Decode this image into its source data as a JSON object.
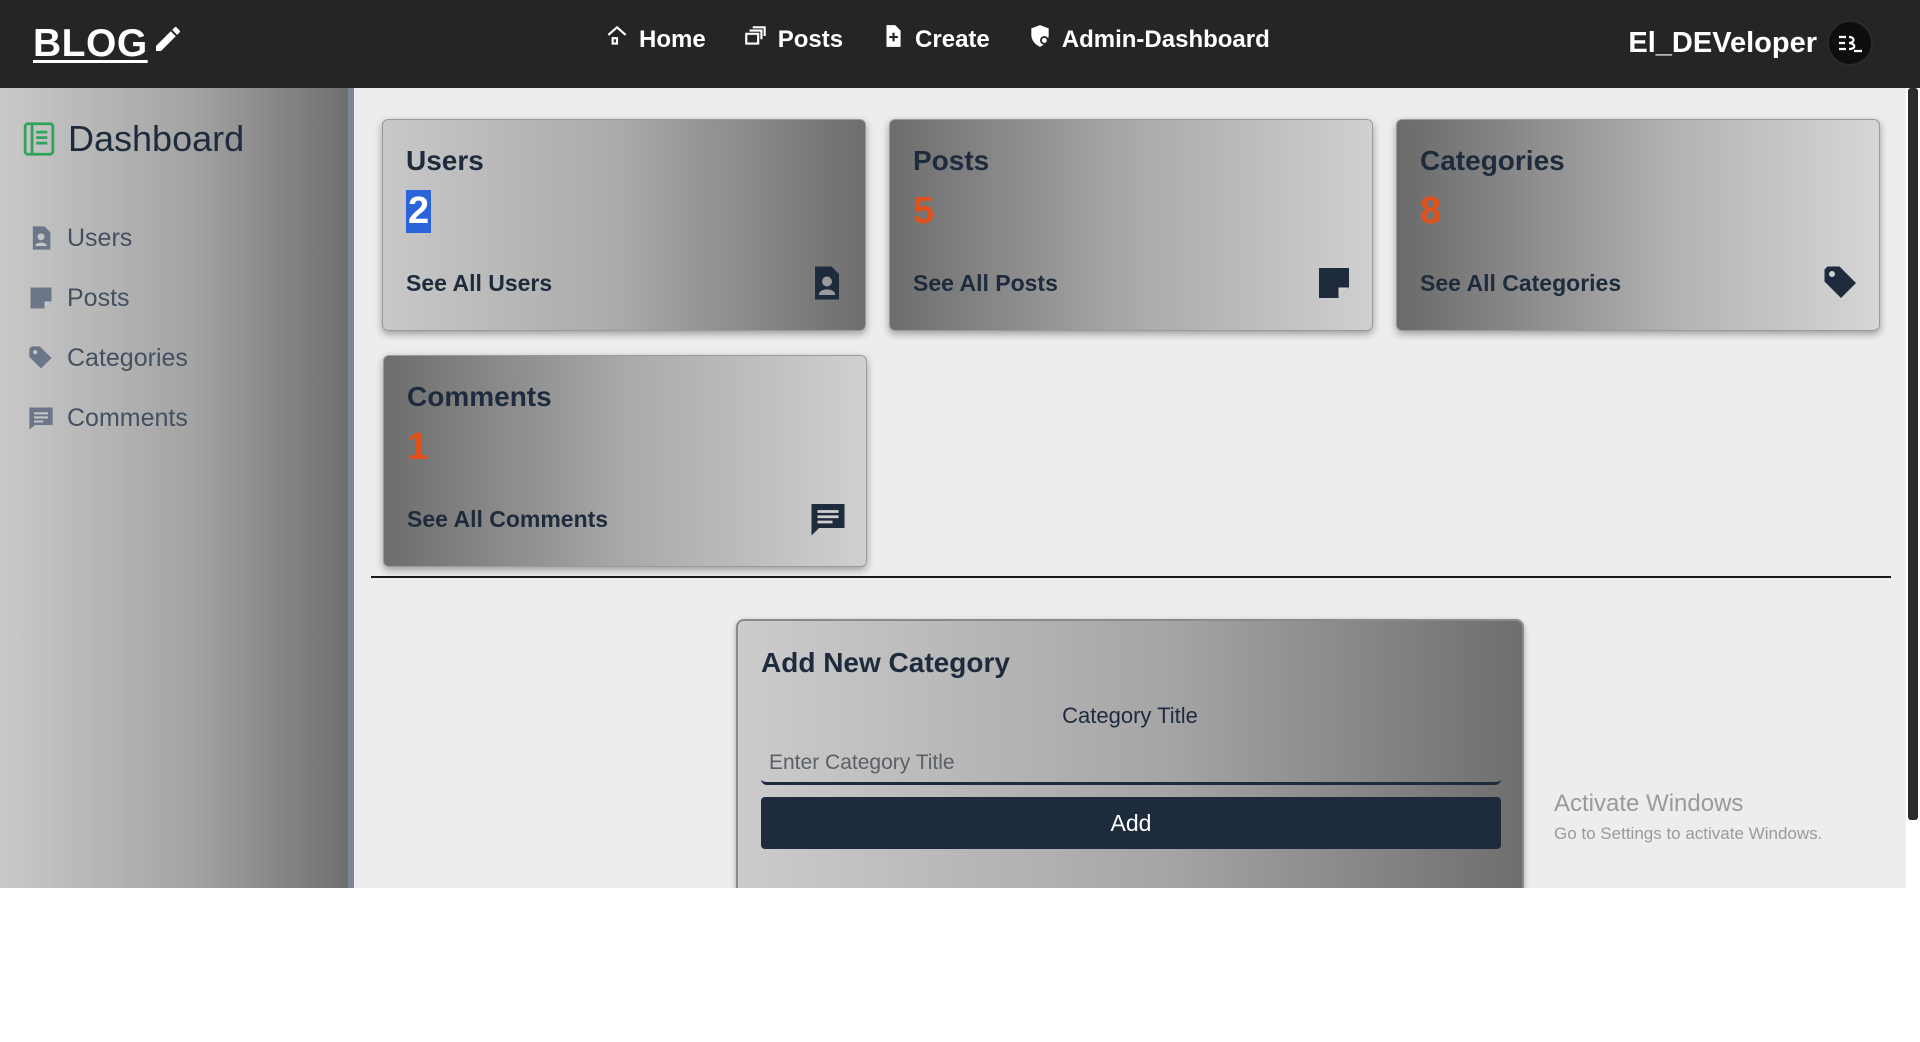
{
  "header": {
    "logo_text": "BLOG",
    "nav": [
      {
        "label": "Home",
        "icon": "home-icon"
      },
      {
        "label": "Posts",
        "icon": "posts-icon"
      },
      {
        "label": "Create",
        "icon": "create-icon"
      },
      {
        "label": "Admin-Dashboard",
        "icon": "admin-icon"
      }
    ],
    "username": "El_DEVeloper"
  },
  "sidebar": {
    "title": "Dashboard",
    "items": [
      {
        "label": "Users",
        "icon": "user-icon"
      },
      {
        "label": "Posts",
        "icon": "posts-icon"
      },
      {
        "label": "Categories",
        "icon": "tag-icon"
      },
      {
        "label": "Comments",
        "icon": "comment-icon"
      }
    ]
  },
  "cards": [
    {
      "title": "Users",
      "value": "2",
      "link": "See All Users",
      "icon": "user-icon"
    },
    {
      "title": "Posts",
      "value": "5",
      "link": "See All Posts",
      "icon": "posts-icon"
    },
    {
      "title": "Categories",
      "value": "8",
      "link": "See All Categories",
      "icon": "tag-icon"
    },
    {
      "title": "Comments",
      "value": "1",
      "link": "See All Comments",
      "icon": "comment-icon"
    }
  ],
  "form": {
    "title": "Add New Category",
    "label": "Category Title",
    "placeholder": "Enter Category Title",
    "button": "Add"
  },
  "watermark": {
    "title": "Activate Windows",
    "subtitle": "Go to Settings to activate Windows."
  },
  "colors": {
    "header_bg": "#242526",
    "accent_orange": "#e0521c",
    "navy": "#1d2b3d",
    "sidebar_icon_green": "#2fa25b"
  }
}
